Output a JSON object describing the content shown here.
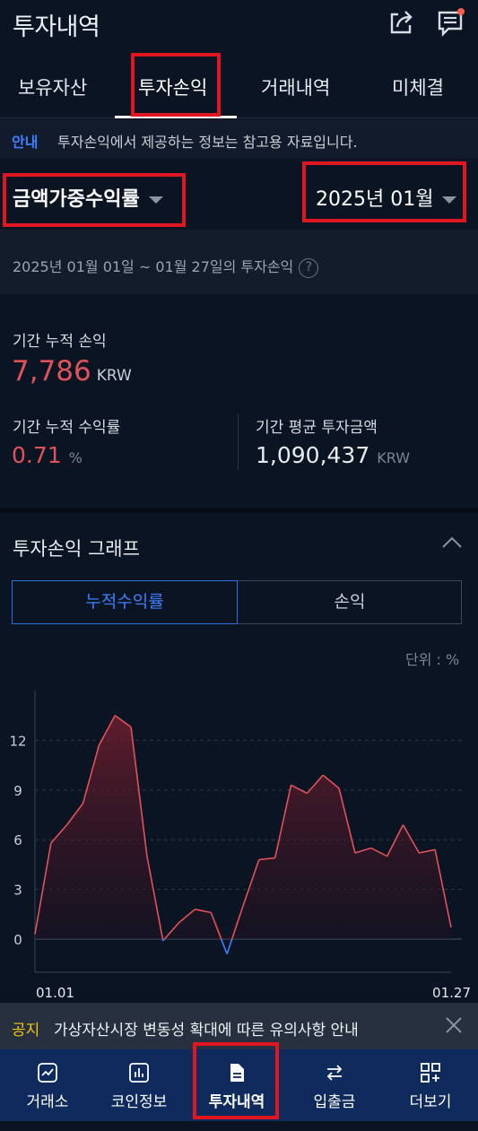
{
  "header": {
    "title": "투자내역",
    "share_icon": "share-icon",
    "message_icon": "message-icon",
    "accent": "#f0604a"
  },
  "tabs": [
    {
      "label": "보유자산"
    },
    {
      "label": "투자손익",
      "active": true
    },
    {
      "label": "거래내역"
    },
    {
      "label": "미체결"
    }
  ],
  "notice": {
    "tag": "안내",
    "text": "투자손익에서 제공하는 정보는 참고용 자료입니다."
  },
  "filters": {
    "metric": "금액가중수익률",
    "month": "2025년 01월"
  },
  "period": {
    "text": "2025년 01월 01일 ~ 01월 27일의 투자손익",
    "help": "?"
  },
  "summary": {
    "cum_pl_label": "기간 누적 손익",
    "cum_pl_value": "7,786",
    "cum_pl_unit": "KRW",
    "cum_rate_label": "기간 누적 수익률",
    "cum_rate_value": "0.71",
    "cum_rate_unit": "%",
    "avg_invest_label": "기간 평균 투자금액",
    "avg_invest_value": "1,090,437",
    "avg_invest_unit": "KRW"
  },
  "graph": {
    "title": "투자손익 그래프",
    "segments": [
      "누적수익률",
      "손익"
    ],
    "unit_label": "단위 : %"
  },
  "chart_data": {
    "type": "area",
    "x": [
      "01.01",
      "01.02",
      "01.03",
      "01.04",
      "01.05",
      "01.06",
      "01.07",
      "01.08",
      "01.09",
      "01.10",
      "01.11",
      "01.12",
      "01.13",
      "01.14",
      "01.15",
      "01.16",
      "01.17",
      "01.18",
      "01.19",
      "01.20",
      "01.21",
      "01.22",
      "01.23",
      "01.24",
      "01.25",
      "01.26",
      "01.27"
    ],
    "values": [
      0.3,
      5.8,
      6.9,
      8.2,
      11.7,
      13.5,
      12.8,
      5.0,
      -0.1,
      1.0,
      1.8,
      1.6,
      -0.9,
      2.0,
      4.8,
      4.9,
      9.3,
      8.8,
      9.9,
      9.1,
      5.2,
      5.5,
      5.0,
      6.9,
      5.2,
      5.4,
      0.7
    ],
    "x_tick_labels": [
      "01.01",
      "01.27"
    ],
    "y_ticks": [
      0,
      3,
      6,
      9,
      12
    ],
    "ylim": [
      -2,
      15
    ],
    "grid": true,
    "colors": {
      "positive": "#e0525a",
      "negative": "#3d7fff"
    }
  },
  "notice_bar": {
    "tag": "공지",
    "text": "가상자산시장 변동성 확대에 따른 유의사항 안내"
  },
  "bottom_nav": [
    {
      "label": "거래소",
      "icon": "exchange-chart-icon"
    },
    {
      "label": "코인정보",
      "icon": "bar-chart-icon"
    },
    {
      "label": "투자내역",
      "icon": "document-icon",
      "active": true
    },
    {
      "label": "입출금",
      "icon": "transfer-arrows-icon"
    },
    {
      "label": "더보기",
      "icon": "grid-plus-icon"
    }
  ]
}
